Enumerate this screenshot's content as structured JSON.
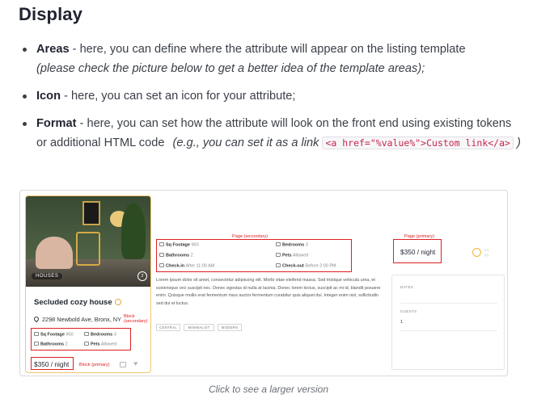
{
  "doc": {
    "heading": "Display",
    "bullets": [
      {
        "term": "Areas",
        "sep": " - ",
        "text": "here, you can define where the attribute will appear on the listing template",
        "note": "(please check the picture below to get a better idea of the template areas);"
      },
      {
        "term": "Icon",
        "sep": " - ",
        "text": "here, you can set an icon for your attribute;"
      },
      {
        "term": "Format",
        "sep": " - ",
        "text": "here, you can set how the attribute will look on the front end using existing tokens or additional HTML code",
        "note_pre": "(e.g., you can set it as a link",
        "code": "<a href=\"%value%\">Custom link</a>",
        "note_post": ")"
      }
    ],
    "caption": "Click to see a larger version"
  },
  "figure": {
    "card": {
      "tag": "HOUSES",
      "photo_count": "2",
      "title": "Secluded cozy house",
      "address": "2298 Newbold Ave, Bronx, NY",
      "block_secondary": "Block (secondary)",
      "block_primary": "Block (primary)",
      "price": "$350 / night",
      "attributes": [
        {
          "label": "Sq Footage",
          "value": "950"
        },
        {
          "label": "Bedrooms",
          "value": "3"
        },
        {
          "label": "Bathrooms",
          "value": "2"
        },
        {
          "label": "Pets",
          "value": "Allowed"
        }
      ]
    },
    "page": {
      "secondary_label": "Page (secondary)",
      "primary_label": "Page (primary)",
      "attributes": [
        {
          "label": "Sq Footage",
          "value": "950"
        },
        {
          "label": "Bedrooms",
          "value": "3"
        },
        {
          "label": "Bathrooms",
          "value": "2"
        },
        {
          "label": "Pets",
          "value": "Allowed"
        },
        {
          "label": "Check-in",
          "value": "After 11:00 AM"
        },
        {
          "label": "Check-out",
          "value": "Before 2:00 PM"
        }
      ],
      "price": "$350 / night",
      "rating_lines": [
        "4.0",
        "(2)"
      ],
      "description": "Lorem ipsum dolor sit amet, consectetur adipiscing elit. Morbi vitae eleifend massa. Sed tristique vehicula urna, et scelerisque orci suscipit nec. Donec egestas id nulla at lacinia. Donec lorem lectus, suscipit ac mi id, blandit posuere enim. Quisque mollis erat fermentum risus auctor fermentum curabitur quis aliquet dui. Integer enim nisl, sollicitudin sed dui et luctus.",
      "tags": [
        "CENTRAL",
        "MINIMALIST",
        "MODERN"
      ],
      "booking": {
        "dates_label": "DATES",
        "guests_label": "GUESTS",
        "guests_value": "1"
      }
    }
  },
  "colors": {
    "accent_red": "#e02020",
    "card_border": "#f0c66b",
    "code_text": "#c7254e"
  }
}
